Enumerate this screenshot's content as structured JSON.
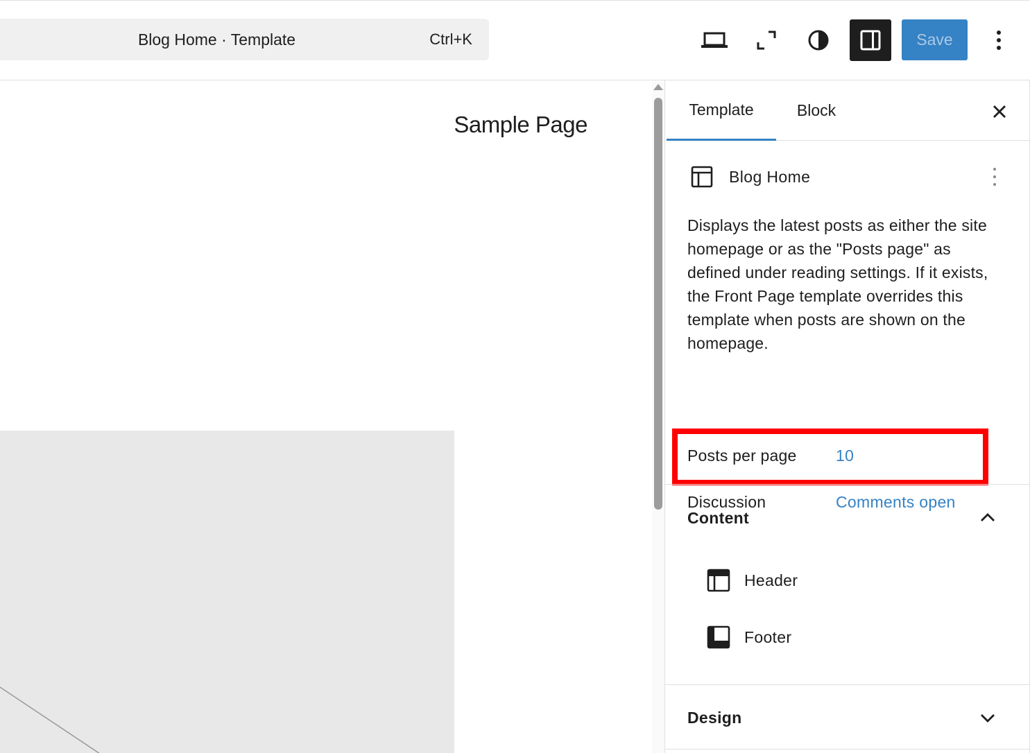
{
  "header": {
    "command_title": "Blog Home · Template",
    "command_shortcut": "Ctrl+K",
    "save_label": "Save"
  },
  "canvas": {
    "nav_link": "Sample Page"
  },
  "sidebar": {
    "tabs": [
      {
        "label": "Template",
        "active": true
      },
      {
        "label": "Block",
        "active": false
      }
    ],
    "template": {
      "title": "Blog Home",
      "description": "Displays the latest posts as either the site homepage or as the \"Posts page\" as defined under reading settings. If it exists, the Front Page template overrides this template when posts are shown on the homepage.",
      "posts_per_page_label": "Posts per page",
      "posts_per_page_value": "10",
      "discussion_label": "Discussion",
      "discussion_value": "Comments open"
    },
    "content_section": {
      "title": "Content",
      "expanded": true,
      "items": [
        {
          "label": "Header",
          "icon": "header-part-icon"
        },
        {
          "label": "Footer",
          "icon": "footer-part-icon"
        }
      ]
    },
    "design_section": {
      "title": "Design",
      "expanded": false
    }
  },
  "colors": {
    "accent": "#3582c4",
    "highlight": "#ff0000",
    "dark": "#1e1e1e"
  }
}
